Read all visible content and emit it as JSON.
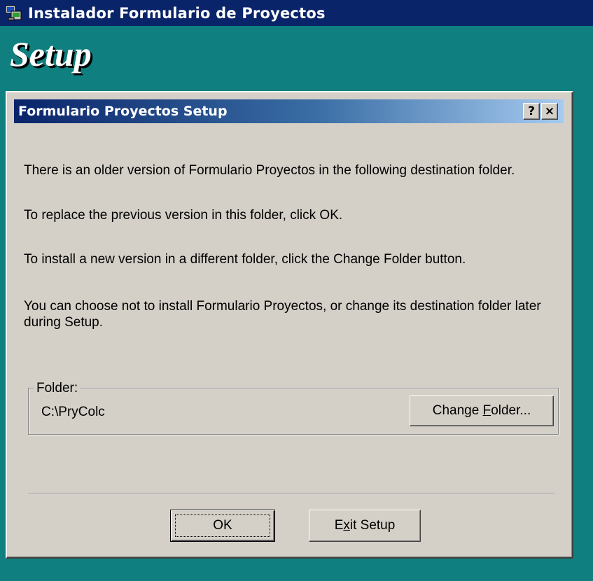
{
  "outer_window": {
    "title": "Instalador Formulario de Proyectos",
    "banner": "Setup"
  },
  "dialog": {
    "title": "Formulario Proyectos Setup",
    "help_button": "?",
    "close_button": "×",
    "messages": [
      "There is an older version of Formulario Proyectos in the following destination folder.",
      "To replace the previous version in this folder, click OK.",
      "To install a new version in a different folder, click the Change Folder button.",
      "You can choose not to install Formulario Proyectos, or change its destination folder later during Setup."
    ],
    "folder": {
      "label": "Folder:",
      "path": "C:\\PryColc",
      "change_button": {
        "before": "Change ",
        "mnemonic": "F",
        "after": "older..."
      }
    },
    "ok_button": "OK",
    "exit_button": {
      "before": "E",
      "mnemonic": "x",
      "after": "it Setup"
    }
  },
  "colors": {
    "desktop": "#0f7f7f",
    "titlebar": "#0a246a",
    "dialog_face": "#d4d0c8"
  },
  "icons": [
    "installer-icon"
  ]
}
